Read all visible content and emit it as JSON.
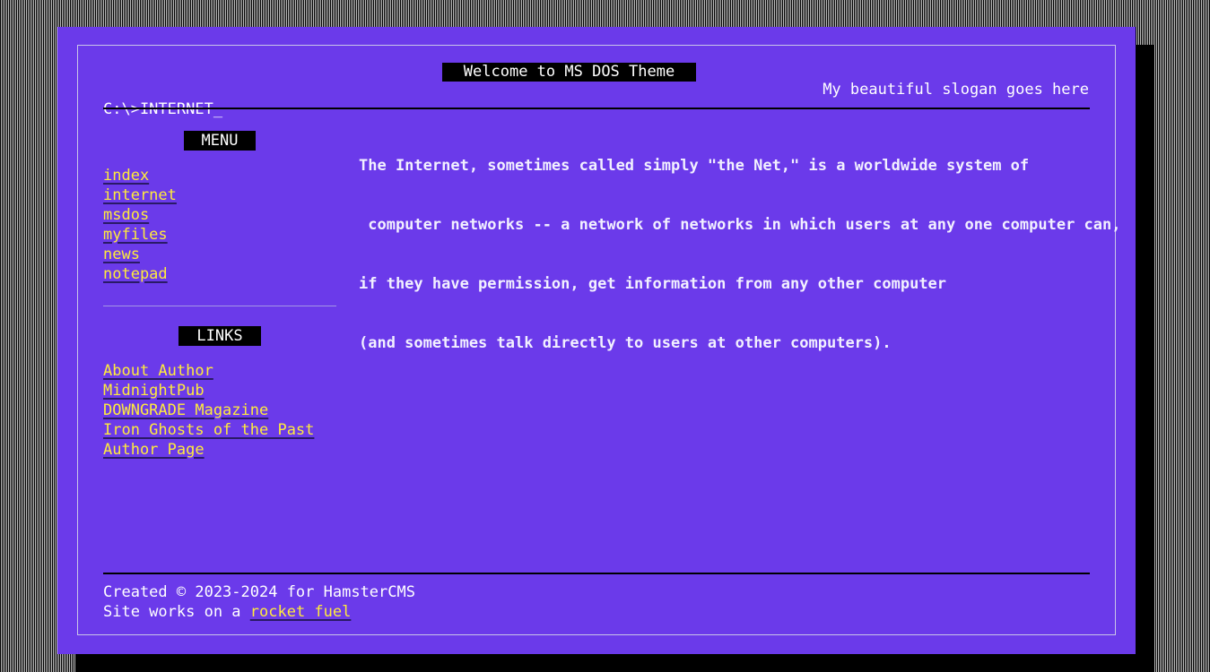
{
  "window": {
    "title": "Welcome to MS DOS Theme",
    "slogan": "My beautiful slogan goes here",
    "prompt": "C:\\>INTERNET_"
  },
  "menu": {
    "heading": "MENU",
    "items": [
      {
        "label": "index"
      },
      {
        "label": "internet"
      },
      {
        "label": "msdos"
      },
      {
        "label": "myfiles"
      },
      {
        "label": "news"
      },
      {
        "label": "notepad"
      }
    ]
  },
  "links": {
    "heading": "LINKS",
    "items": [
      {
        "label": "About Author"
      },
      {
        "label": "MidnightPub"
      },
      {
        "label": "DOWNGRADE Magazine"
      },
      {
        "label": "Iron Ghosts of the Past"
      },
      {
        "label": "Author Page"
      }
    ]
  },
  "content": {
    "lines": [
      "The Internet, sometimes called simply \"the Net,\" is a worldwide system of",
      " computer networks -- a network of networks in which users at any one computer can,",
      "if they have permission, get information from any other computer",
      "(and sometimes talk directly to users at other computers)."
    ]
  },
  "footer": {
    "created": "Created © 2023-2024 for HamsterCMS",
    "works_prefix": "Site works on a ",
    "works_link": "rocket fuel"
  },
  "colors": {
    "background": "#6b3aea",
    "link": "#ffeb3b",
    "text": "#ffffff",
    "heading_bg": "#000000"
  }
}
